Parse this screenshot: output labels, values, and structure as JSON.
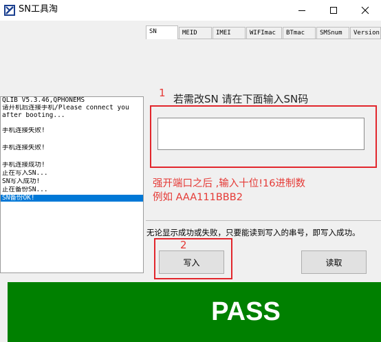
{
  "window": {
    "title": "SN工具淘"
  },
  "tabs": [
    "SN",
    "MEID",
    "IMEI",
    "WIFImac",
    "BTmac",
    "SMSnum",
    "Version"
  ],
  "log": {
    "lines": [
      "QLIB V5.3.46,QPHONEMS",
      "请开机后连接手机/Please connect you",
      "after booting...",
      "",
      "手机连接失败!",
      "",
      "手机连接失败!",
      "",
      "手机连接成功!",
      "正在写入SN...",
      "SN写入成功!",
      "正在备份SN...",
      "SN备份OK!"
    ],
    "selected_index": 12
  },
  "annotations": {
    "step1": "1",
    "step2": "2"
  },
  "sn_form": {
    "prompt": "若需改SN 请在下面输入SN码",
    "input_value": "",
    "hint_line1": "强开端口之后 ,输入十位!16进制数",
    "hint_line2": "例如 AAA111BBB2"
  },
  "note": "无论显示成功或失败，只要能读到写入的串号，即写入成功。",
  "buttons": {
    "write": "写入",
    "read": "读取"
  },
  "status": {
    "result": "PASS",
    "color": "#008000"
  }
}
